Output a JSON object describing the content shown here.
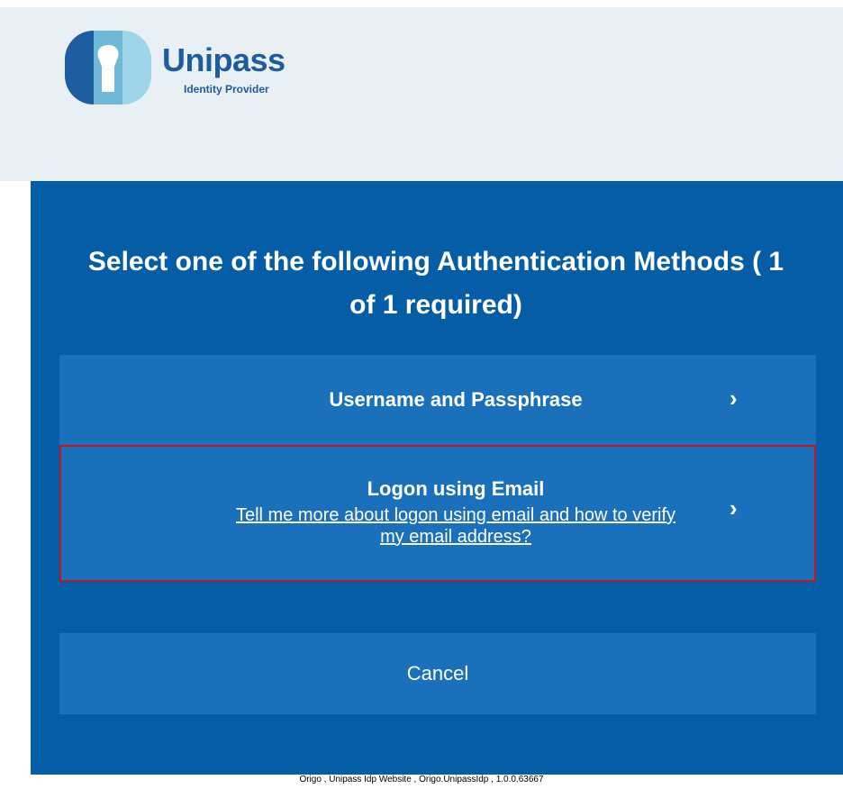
{
  "brand": {
    "name": "Unipass",
    "tagline": "Identity Provider",
    "logo_icon": "keyhole-logo-icon",
    "colors": {
      "dark": "#1d5c9f",
      "light": "#9ed5e8"
    }
  },
  "panel": {
    "title": "Select one of the following Authentication Methods ( 1 of 1 required)",
    "background": "#055da6"
  },
  "methods": [
    {
      "label": "Username and Passphrase",
      "icon": "chevron-right-icon"
    },
    {
      "label": "Logon using Email",
      "link": "Tell me more about logon using email and how to verify my email address?",
      "icon": "chevron-right-icon",
      "highlight_color": "#c4161c"
    }
  ],
  "cancel_label": "Cancel",
  "footer": "Origo , Unipass Idp Website , Origo.UnipassIdp , 1.0.0.63667"
}
